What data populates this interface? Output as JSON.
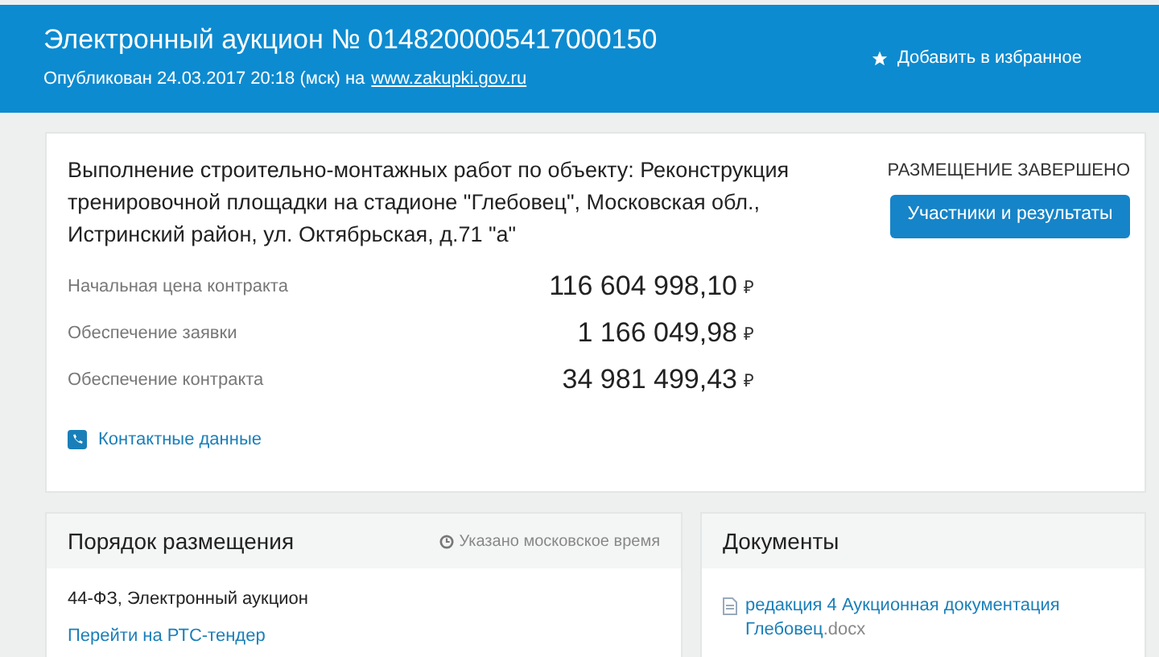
{
  "header": {
    "title": "Электронный аукцион № 0148200005417000150",
    "published": "Опубликован 24.03.2017 20:18 (мск) на",
    "site_link": "www.zakupki.gov.ru",
    "favorite": "Добавить в избранное"
  },
  "summary": {
    "description": "Выполнение строительно-монтажных работ по объекту: Реконструкция тренировочной площадки на стадионе \"Глебовец\", Московская обл., Истринский район, ул. Октябрьская, д.71 \"а\"",
    "status": "РАЗМЕЩЕНИЕ ЗАВЕРШЕНО",
    "results_button": "Участники и результаты",
    "amounts": [
      {
        "label": "Начальная цена контракта",
        "value": "116 604 998,10",
        "currency": "₽"
      },
      {
        "label": "Обеспечение заявки",
        "value": "1 166 049,98",
        "currency": "₽"
      },
      {
        "label": "Обеспечение контракта",
        "value": "34 981 499,43",
        "currency": "₽"
      }
    ],
    "contacts_link": "Контактные данные"
  },
  "procedure": {
    "title": "Порядок размещения",
    "time_note": "Указано московское время",
    "law": "44-ФЗ, Электронный аукцион",
    "platform_link": "Перейти на РТС-тендер"
  },
  "documents": {
    "title": "Документы",
    "files": [
      {
        "name": "редакция 4 Аукционная документация Глебовец",
        "extension": ".docx"
      }
    ]
  }
}
